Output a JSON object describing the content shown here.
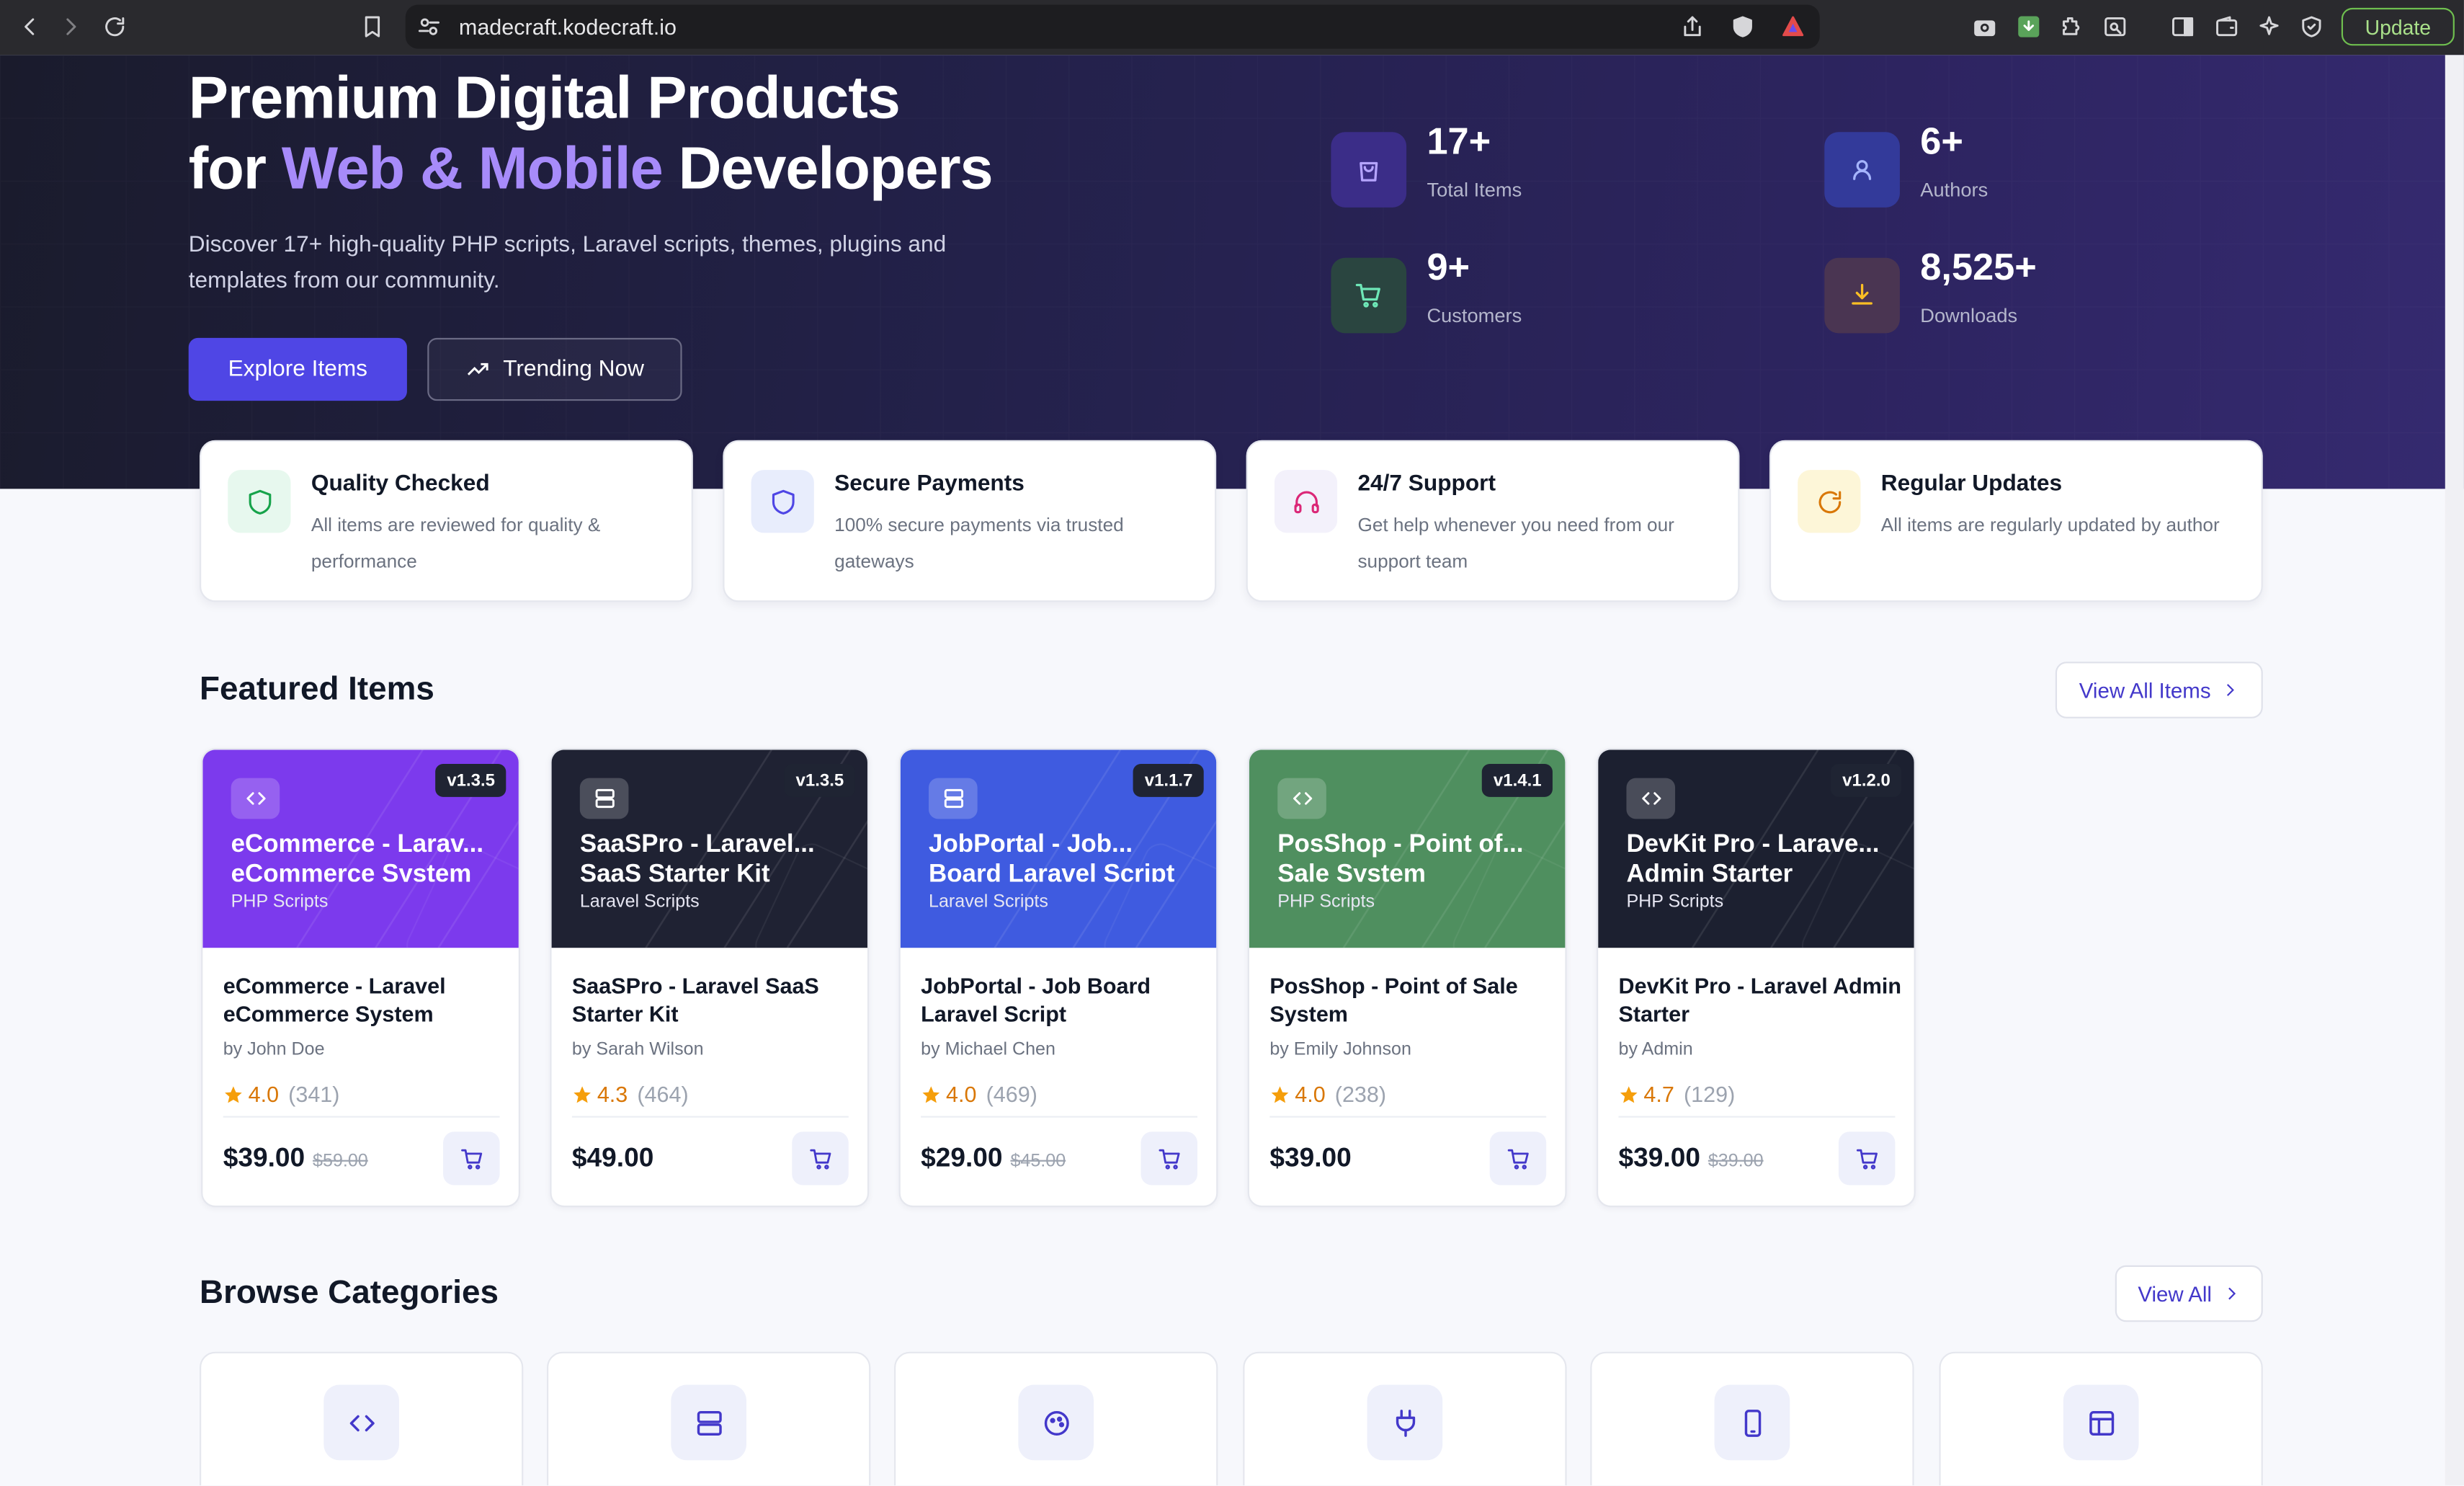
{
  "browser": {
    "url": "madecraft.kodecraft.io",
    "update_label": "Update"
  },
  "hero": {
    "title_line1": "Premium Digital Products",
    "title_prefix": "for",
    "title_highlight": "Web & Mobile",
    "title_suffix": "Developers",
    "description": "Discover 17+ high-quality PHP scripts, Laravel scripts, themes, plugins and templates from our community.",
    "explore_label": "Explore Items",
    "trending_label": "Trending Now",
    "stats": [
      {
        "value": "17+",
        "label": "Total Items",
        "icon": "shopping-bag-icon"
      },
      {
        "value": "6+",
        "label": "Authors",
        "icon": "user-icon"
      },
      {
        "value": "9+",
        "label": "Customers",
        "icon": "cart-icon"
      },
      {
        "value": "8,525+",
        "label": "Downloads",
        "icon": "download-icon"
      }
    ]
  },
  "features": [
    {
      "title": "Quality Checked",
      "desc": "All items are reviewed for quality & performance",
      "icon": "shield-check-icon"
    },
    {
      "title": "Secure Payments",
      "desc": "100% secure payments via trusted gateways",
      "icon": "shield-icon"
    },
    {
      "title": "24/7 Support",
      "desc": "Get help whenever you need from our support team",
      "icon": "headphones-icon"
    },
    {
      "title": "Regular Updates",
      "desc": "All items are regularly updated by author",
      "icon": "refresh-icon"
    }
  ],
  "featured": {
    "title": "Featured Items",
    "view_all_label": "View All Items",
    "items": [
      {
        "version": "v1.3.5",
        "banner_line1": "eCommerce - Larav...",
        "banner_line2": "eCommerce System",
        "category": "PHP Scripts",
        "name": "eCommerce - Laravel eCommerce System",
        "author": "by John Doe",
        "rating": "4.0",
        "reviews": "(341)",
        "price": "$39.00",
        "old_price": "$59.00",
        "icon": "code-icon",
        "color": "#7c3aed"
      },
      {
        "version": "v1.3.5",
        "banner_line1": "SaaSPro - Laravel...",
        "banner_line2": "SaaS Starter Kit",
        "category": "Laravel Scripts",
        "name": "SaaSPro - Laravel SaaS Starter Kit",
        "author": "by Sarah Wilson",
        "rating": "4.3",
        "reviews": "(464)",
        "price": "$49.00",
        "old_price": "",
        "icon": "server-icon",
        "color": "#1f2233"
      },
      {
        "version": "v1.1.7",
        "banner_line1": "JobPortal - Job...",
        "banner_line2": "Board Laravel Script",
        "category": "Laravel Scripts",
        "name": "JobPortal - Job Board Laravel Script",
        "author": "by Michael Chen",
        "rating": "4.0",
        "reviews": "(469)",
        "price": "$29.00",
        "old_price": "$45.00",
        "icon": "server-icon",
        "color": "#3f5be0"
      },
      {
        "version": "v1.4.1",
        "banner_line1": "PosShop - Point of...",
        "banner_line2": "Sale System",
        "category": "PHP Scripts",
        "name": "PosShop - Point of Sale System",
        "author": "by Emily Johnson",
        "rating": "4.0",
        "reviews": "(238)",
        "price": "$39.00",
        "old_price": "",
        "icon": "code-icon",
        "color": "#4f8f5f"
      },
      {
        "version": "v1.2.0",
        "banner_line1": "DevKit Pro - Larave...",
        "banner_line2": "Admin Starter",
        "category": "PHP Scripts",
        "name": "DevKit Pro - Laravel Admin Starter",
        "author": "by Admin",
        "rating": "4.7",
        "reviews": "(129)",
        "price": "$39.00",
        "old_price": "$39.00",
        "icon": "code-icon",
        "color": "#1c2030"
      }
    ]
  },
  "categories": {
    "title": "Browse Categories",
    "view_all_label": "View All",
    "items": [
      {
        "icon": "code-icon"
      },
      {
        "icon": "server-icon"
      },
      {
        "icon": "palette-icon"
      },
      {
        "icon": "plug-icon"
      },
      {
        "icon": "smartphone-icon"
      },
      {
        "icon": "layout-icon"
      }
    ]
  }
}
